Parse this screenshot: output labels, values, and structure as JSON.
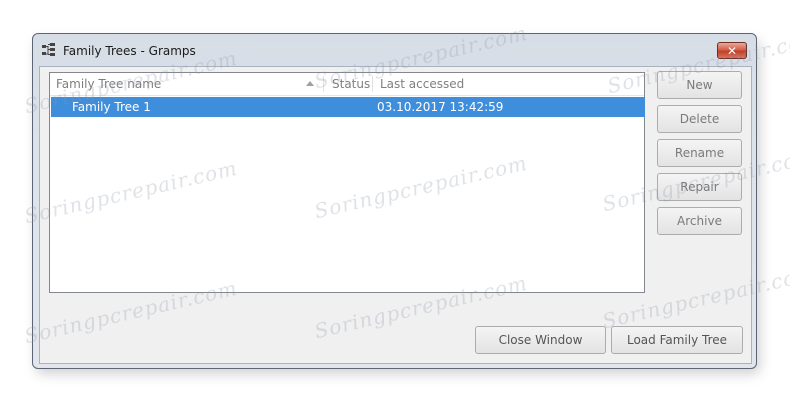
{
  "window": {
    "title": "Family Trees - Gramps",
    "close_label": "✕"
  },
  "list": {
    "columns": [
      {
        "label": "Family Tree name"
      },
      {
        "label": "Status"
      },
      {
        "label": "Last accessed"
      }
    ],
    "rows": [
      {
        "name": "Family Tree 1",
        "status": "",
        "last_accessed": "03.10.2017 13:42:59",
        "selected": true
      }
    ]
  },
  "side_buttons": {
    "new": "New",
    "delete": "Delete",
    "rename": "Rename",
    "repair": "Repair",
    "archive": "Archive"
  },
  "bottom_buttons": {
    "close_window": "Close Window",
    "load_family_tree": "Load Family Tree"
  },
  "watermark": "Soringpcrepair.com",
  "colors": {
    "selection": "#3f8edc",
    "close_button": "#c13f28"
  }
}
